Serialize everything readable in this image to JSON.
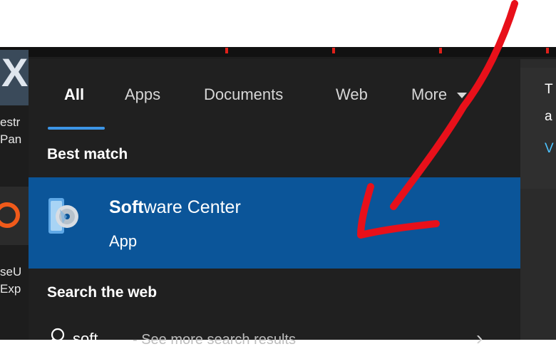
{
  "desktop": {
    "icon_top_label_1": "estr",
    "icon_top_label_2": "Pan",
    "icon_mid_label_1": "seU",
    "icon_mid_label_2": "Exp",
    "strip_mark_char": "0"
  },
  "tabs": [
    {
      "label": "All",
      "active": true
    },
    {
      "label": "Apps"
    },
    {
      "label": "Documents"
    },
    {
      "label": "Web"
    },
    {
      "label": "More"
    }
  ],
  "best_match": {
    "section_label": "Best match",
    "title_bold": "Soft",
    "title_rest": "ware Center",
    "subtitle": "App",
    "icon": "software-center-icon"
  },
  "search_web": {
    "section_label": "Search the web",
    "query": "soft",
    "hint": "- See more search results",
    "icon": "search-icon",
    "arrow_icon": "chevron-right-icon"
  },
  "right_panel": {
    "line1": "T",
    "line2": "a",
    "line3": "V"
  },
  "colors": {
    "panel_bg": "#202020",
    "highlight_bg": "#0b5599",
    "accent": "#3c95e6",
    "annotation_red": "#e8101a"
  }
}
